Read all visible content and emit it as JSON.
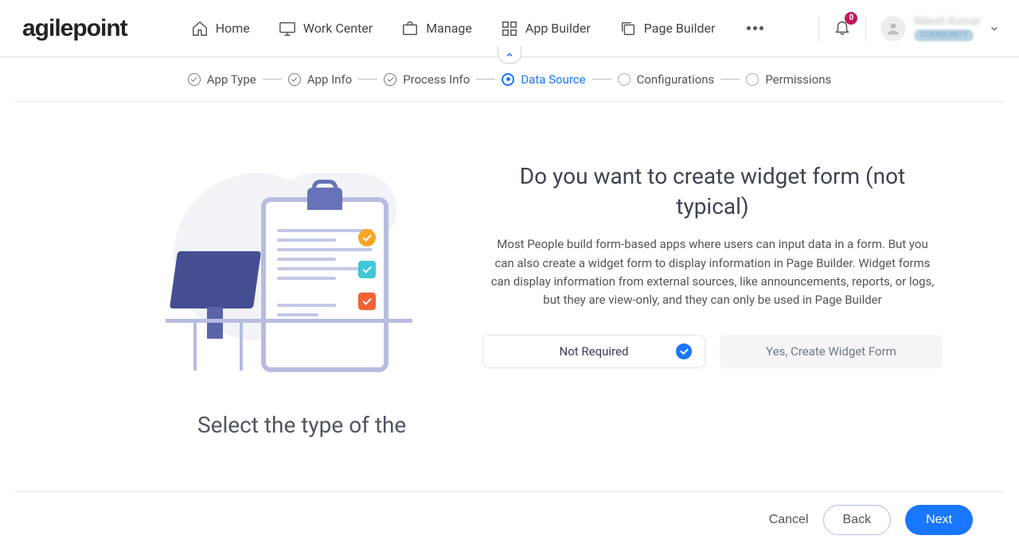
{
  "logo": {
    "part1": "agile",
    "part2": "point"
  },
  "nav": {
    "home": "Home",
    "workcenter": "Work Center",
    "manage": "Manage",
    "appbuilder": "App Builder",
    "pagebuilder": "Page Builder"
  },
  "notif_count": "0",
  "user": {
    "name": "Nilesh Kumar",
    "badge": "COMMUNITY"
  },
  "wizard": {
    "app_type": "App Type",
    "app_info": "App Info",
    "process_info": "Process Info",
    "data_source": "Data Source",
    "configurations": "Configurations",
    "permissions": "Permissions"
  },
  "section": {
    "heading": "Do you want to create widget form (not typical)",
    "desc": "Most People build form-based apps where users can input data in a form. But you can also create a widget form to display information in Page Builder. Widget forms can display information from external sources, like announcements, reports, or logs, but they are view-only, and they can only be used in Page Builder",
    "option_not_required": "Not Required",
    "option_yes": "Yes, Create Widget Form"
  },
  "second_heading": "Select the type of the",
  "footer": {
    "cancel": "Cancel",
    "back": "Back",
    "next": "Next"
  }
}
